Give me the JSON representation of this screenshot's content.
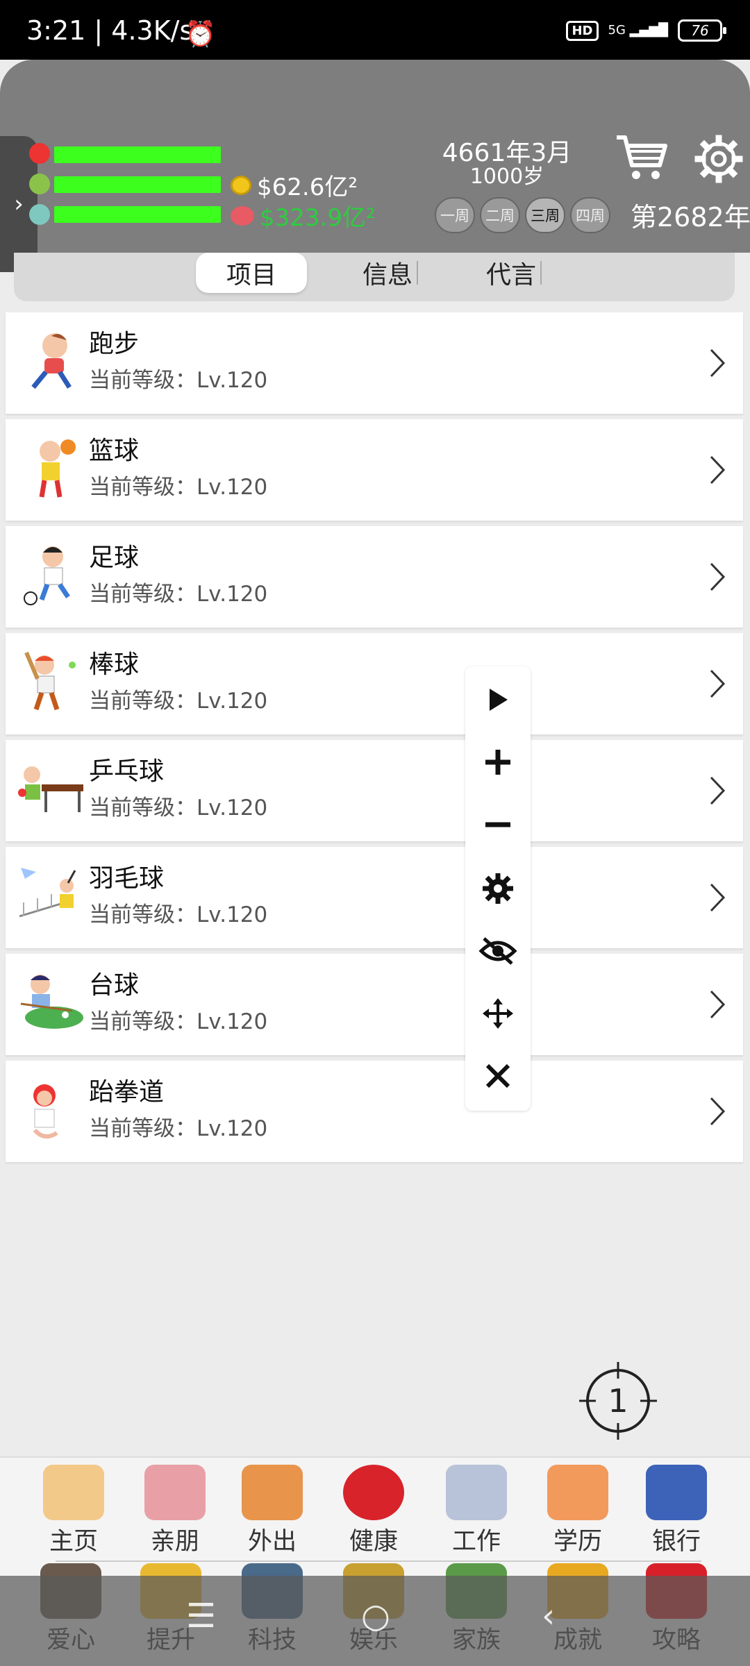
{
  "status": {
    "time": "3:21 | 4.3K/s",
    "hd": "HD",
    "network": "5G",
    "battery": "76"
  },
  "header": {
    "money_gold": "$62.6亿²",
    "money_red": "$323.9亿²",
    "date": "4661年3月",
    "age": "1000岁",
    "weeks": [
      "一周",
      "二周",
      "三周",
      "四周"
    ],
    "selected_week": "三周",
    "year": "第2682年",
    "bars": [
      1.0,
      1.0,
      1.0
    ]
  },
  "tabs": [
    "项目",
    "信息",
    "代言"
  ],
  "active_tab": "项目",
  "items": [
    {
      "title": "跑步",
      "level": "当前等级：Lv.120"
    },
    {
      "title": "篮球",
      "level": "当前等级：Lv.120"
    },
    {
      "title": "足球",
      "level": "当前等级：Lv.120"
    },
    {
      "title": "棒球",
      "level": "当前等级：Lv.120"
    },
    {
      "title": "乒乓球",
      "level": "当前等级：Lv.120"
    },
    {
      "title": "羽毛球",
      "level": "当前等级：Lv.120"
    },
    {
      "title": "台球",
      "level": "当前等级：Lv.120"
    },
    {
      "title": "跆拳道",
      "level": "当前等级：Lv.120"
    }
  ],
  "crosshair_label": "1",
  "nav_row1": [
    "主页",
    "亲朋",
    "外出",
    "健康",
    "工作",
    "学历",
    "银行"
  ],
  "nav_row2": [
    "爱心",
    "提升",
    "科技",
    "娱乐",
    "家族",
    "成就",
    "攻略"
  ],
  "colors": {
    "bar": "#3cff1e",
    "header_bg": "#7e7e7e",
    "money_red": "#2ecc40"
  }
}
